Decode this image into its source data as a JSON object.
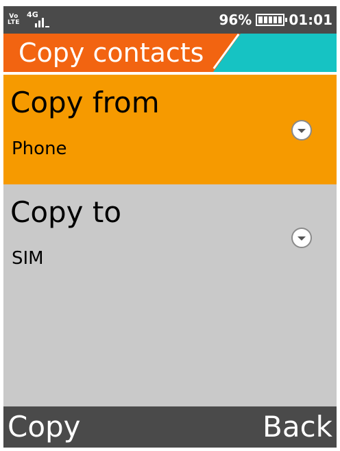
{
  "status_bar": {
    "volte_label_top": "Vo",
    "volte_label_bottom": "LTE",
    "network_type": "4G",
    "signal_level_bars": 3,
    "battery_percent": "96%",
    "battery_level": 0.96,
    "time": "01:01"
  },
  "header": {
    "title": "Copy contacts"
  },
  "items": [
    {
      "label": "Copy from",
      "value": "Phone",
      "selected": true,
      "icon": "chevron-down-icon"
    },
    {
      "label": "Copy to",
      "value": "SIM",
      "selected": false,
      "icon": "chevron-down-icon"
    }
  ],
  "softkeys": {
    "left": "Copy",
    "right": "Back"
  },
  "colors": {
    "status_bar_bg": "#4a4a4a",
    "title_orange": "#f26411",
    "title_cyan": "#16c3c3",
    "selected_item_bg": "#f69a00",
    "content_bg": "#c9c9c9",
    "softkey_bg": "#4a4a4a"
  }
}
